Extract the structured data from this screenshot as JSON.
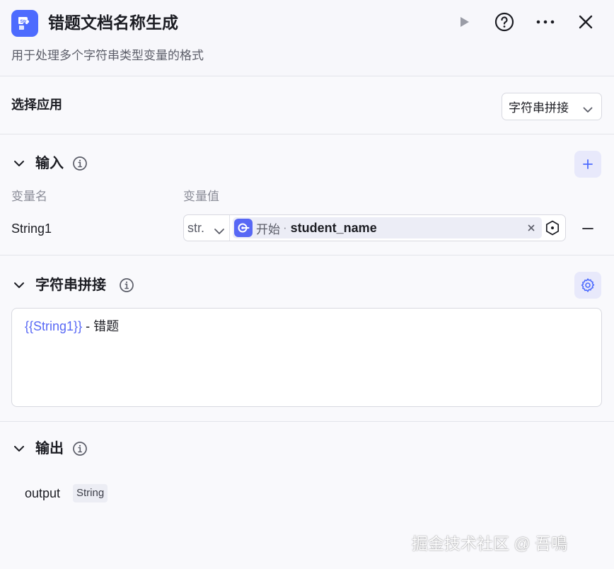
{
  "header": {
    "title": "错题文档名称生成",
    "subtitle": "用于处理多个字符串类型变量的格式",
    "app_icon": "str-icon",
    "actions": [
      "run-icon",
      "help-icon",
      "more-icon",
      "close-icon"
    ]
  },
  "app_select": {
    "label": "选择应用",
    "value": "字符串拼接"
  },
  "input_section": {
    "title": "输入",
    "col_name": "变量名",
    "col_value": "变量值",
    "rows": [
      {
        "name": "String1",
        "type": "str.",
        "source": "开始",
        "separator": "·",
        "variable": "student_name"
      }
    ]
  },
  "concat_section": {
    "title": "字符串拼接",
    "template_var": "{{String1}}",
    "template_text": " - 错题"
  },
  "output_section": {
    "title": "输出",
    "name": "output",
    "type": "String"
  },
  "watermark": "掘金技术社区 @ 吾鳴",
  "colors": {
    "accent": "#4d6bfe",
    "accent_soft": "#e8e9fb",
    "variable": "#5868f5"
  }
}
